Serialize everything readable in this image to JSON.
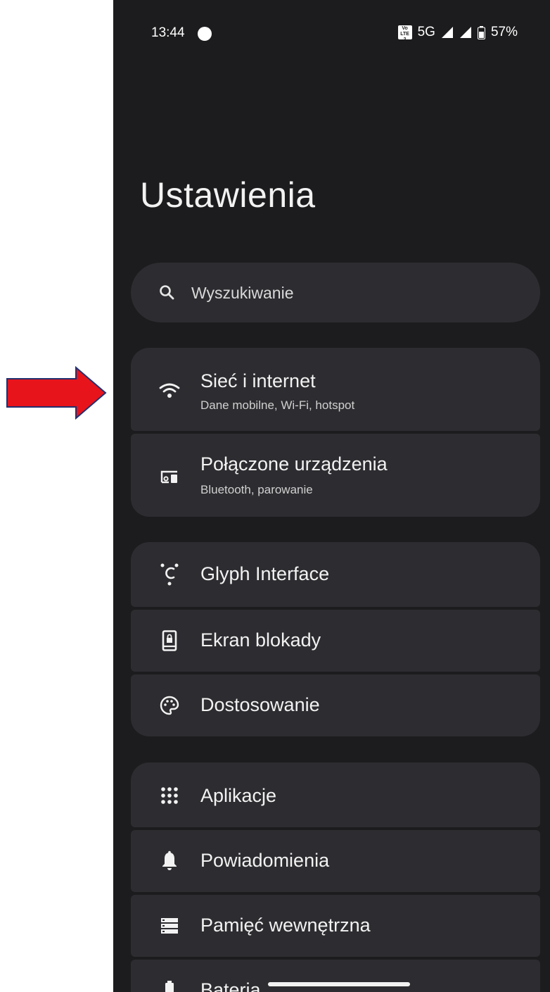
{
  "status": {
    "time": "13:44",
    "lte_top": "Vo",
    "lte_bottom": "LTE 2",
    "network": "5G",
    "battery": "57%"
  },
  "page": {
    "title": "Ustawienia"
  },
  "search": {
    "placeholder": "Wyszukiwanie"
  },
  "items": [
    {
      "label": "Sieć i internet",
      "sub": "Dane mobilne, Wi-Fi, hotspot",
      "icon": "wifi-icon"
    },
    {
      "label": "Połączone urządzenia",
      "sub": "Bluetooth, parowanie",
      "icon": "connected-devices-icon"
    },
    {
      "label": "Glyph Interface",
      "icon": "glyph-icon"
    },
    {
      "label": "Ekran blokady",
      "icon": "lock-screen-icon"
    },
    {
      "label": "Dostosowanie",
      "icon": "palette-icon"
    },
    {
      "label": "Aplikacje",
      "icon": "apps-grid-icon"
    },
    {
      "label": "Powiadomienia",
      "icon": "bell-icon"
    },
    {
      "label": "Pamięć wewnętrzna",
      "icon": "storage-icon"
    },
    {
      "label": "Bateria",
      "icon": "battery-icon"
    }
  ],
  "colors": {
    "background": "#1c1c1e",
    "card": "#2d2d31",
    "text": "#f2f2f2",
    "arrow": "#e8141c"
  }
}
